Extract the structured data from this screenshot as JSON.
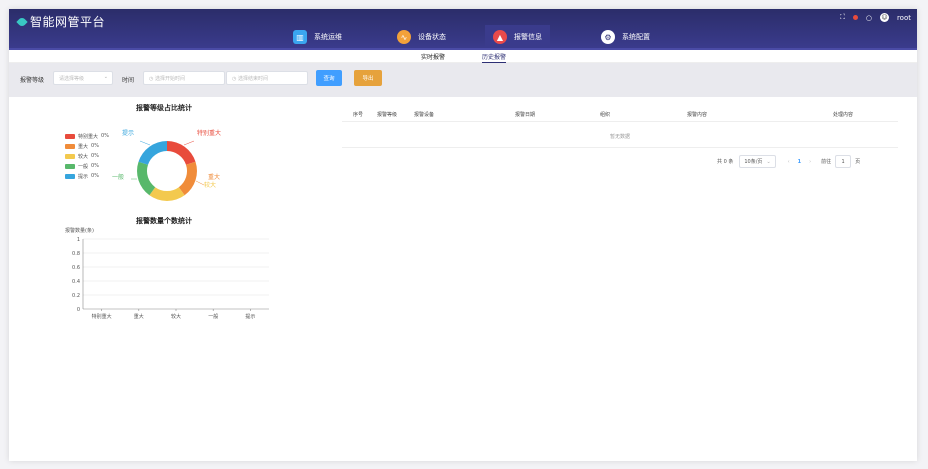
{
  "app": {
    "title": "智能网管平台",
    "user": "root"
  },
  "colors": {
    "topbar": "#2d2f74",
    "accent": "#409eff",
    "export": "#e6a23c"
  },
  "nav": [
    {
      "label": "系统运维",
      "icon": "chart-icon",
      "color": "#3aa6ef"
    },
    {
      "label": "设备状态",
      "icon": "wave-icon",
      "color": "#f2a13a"
    },
    {
      "label": "报警信息",
      "icon": "alarm-icon",
      "color": "#e94a4a",
      "active": true
    },
    {
      "label": "系统配置",
      "icon": "gear-icon",
      "color": "#777"
    }
  ],
  "subtabs": [
    {
      "label": "实时报警"
    },
    {
      "label": "历史报警",
      "active": true
    }
  ],
  "filter": {
    "level_label": "报警等级",
    "level_placeholder": "请选择等级",
    "time_label": "时间",
    "start_placeholder": "选择开始时间",
    "end_placeholder": "选择结束时间",
    "query": "查询",
    "export": "导出"
  },
  "donut": {
    "title": "报警等级占比统计",
    "legend": [
      {
        "name": "特别重大",
        "value": "0%",
        "color": "#e84b3c"
      },
      {
        "name": "重大",
        "value": "0%",
        "color": "#f08c3a"
      },
      {
        "name": "较大",
        "value": "0%",
        "color": "#f3c94e"
      },
      {
        "name": "一般",
        "value": "0%",
        "color": "#58b86b"
      },
      {
        "name": "提示",
        "value": "0%",
        "color": "#36a5dd"
      }
    ],
    "labels": {
      "tebie": "特别重大",
      "zhongda": "重大",
      "jiaoda": "较大",
      "yiban": "一般",
      "tishi": "提示"
    }
  },
  "chart_data": {
    "type": "bar",
    "title": "报警数量个数统计",
    "ylabel": "报警数量(条)",
    "categories": [
      "特别重大",
      "重大",
      "较大",
      "一般",
      "提示"
    ],
    "values": [
      0,
      0,
      0,
      0,
      0
    ],
    "ylim": [
      0,
      1
    ],
    "yticks": [
      "0",
      "0.2",
      "0.4",
      "0.6",
      "0.8",
      "1"
    ],
    "grid": true
  },
  "table": {
    "columns": [
      "序号",
      "报警等级",
      "报警设备",
      "报警日期",
      "组织",
      "报警内容",
      "处理内容"
    ],
    "empty_text": "暂无数据"
  },
  "pager": {
    "total": "共 0 条",
    "page_size": "10条/页",
    "prev": "‹",
    "current": "1",
    "next": "›",
    "goto_prefix": "前往",
    "goto_value": "1",
    "goto_suffix": "页"
  }
}
